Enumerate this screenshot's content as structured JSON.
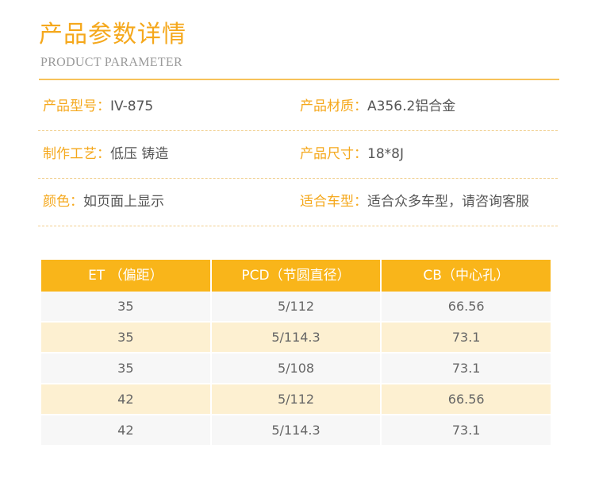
{
  "header": {
    "title": "产品参数详情",
    "subtitle": "PRODUCT PARAMETER"
  },
  "params": [
    {
      "left_label": "产品型号：",
      "left_value": "IV-875",
      "right_label": "产品材质：",
      "right_value": "A356.2铝合金"
    },
    {
      "left_label": "制作工艺：",
      "left_value": "低压 铸造",
      "right_label": "产品尺寸：",
      "right_value": "18*8J"
    },
    {
      "left_label": "颜色：",
      "left_value": "如页面上显示",
      "right_label": "适合车型：",
      "right_value": "适合众多车型，请咨询客服"
    }
  ],
  "table": {
    "headers": [
      "ET （偏距）",
      "PCD（节圆直径）",
      "CB（中心孔）"
    ],
    "rows": [
      [
        "35",
        "5/112",
        "66.56"
      ],
      [
        "35",
        "5/114.3",
        "73.1"
      ],
      [
        "35",
        "5/108",
        "73.1"
      ],
      [
        "42",
        "5/112",
        "66.56"
      ],
      [
        "42",
        "5/114.3",
        "73.1"
      ]
    ]
  },
  "colors": {
    "accent": "#f5a81c",
    "header_bg": "#f9b51a",
    "row_alt": "#fdf0d1",
    "row_plain": "#f7f7f7"
  }
}
